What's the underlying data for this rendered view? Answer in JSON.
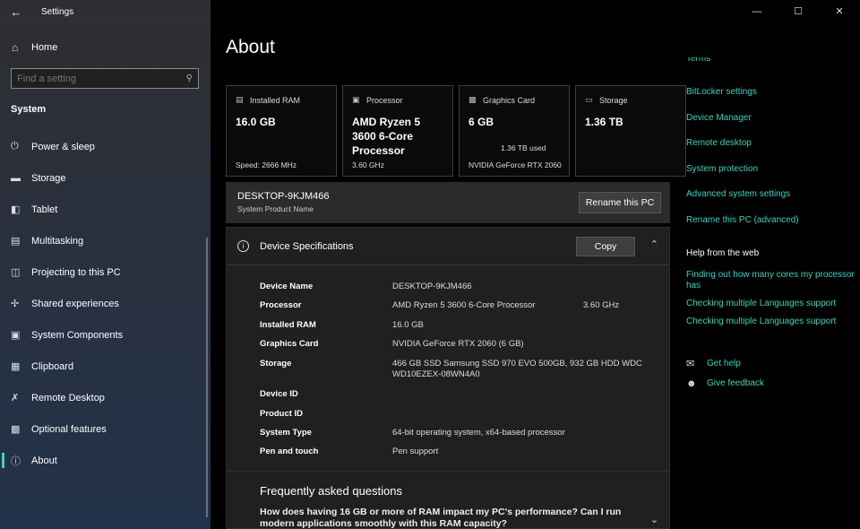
{
  "window": {
    "title": "Settings",
    "controls": [
      "—",
      "☐",
      "✕"
    ]
  },
  "sidebar": {
    "home_label": "Home",
    "search_placeholder": "Find a setting",
    "group_label": "System",
    "items": [
      {
        "label": "Power & sleep",
        "icon": "power-icon"
      },
      {
        "label": "Storage",
        "icon": "storage-icon"
      },
      {
        "label": "Tablet",
        "icon": "tablet-icon"
      },
      {
        "label": "Multitasking",
        "icon": "multitasking-icon"
      },
      {
        "label": "Projecting to this PC",
        "icon": "projecting-icon"
      },
      {
        "label": "Shared experiences",
        "icon": "shared-icon"
      },
      {
        "label": "System Components",
        "icon": "components-icon"
      },
      {
        "label": "Clipboard",
        "icon": "clipboard-icon"
      },
      {
        "label": "Remote Desktop",
        "icon": "remote-icon"
      },
      {
        "label": "Optional features",
        "icon": "features-icon"
      },
      {
        "label": "About",
        "icon": "info-icon",
        "active": true
      }
    ]
  },
  "main": {
    "title": "About",
    "cards": [
      {
        "label": "Installed RAM",
        "value": "16.0 GB",
        "sub": "Speed: 2666 MHz"
      },
      {
        "label": "Processor",
        "value": "AMD Ryzen 5 3600 6-Core Processor",
        "sub": "3.60 GHz"
      },
      {
        "label": "Graphics Card",
        "value": "6 GB",
        "sub": "NVIDIA GeForce RTX 2060"
      },
      {
        "label": "Storage",
        "value": "1.36 TB",
        "sub": "1.36 TB used"
      }
    ],
    "pc_name": {
      "name": "DESKTOP-9KJM466",
      "sub": "System Product Name",
      "rename_label": "Rename this PC"
    },
    "specs": {
      "title": "Device Specifications",
      "copy_label": "Copy",
      "rows": [
        {
          "label": "Device Name",
          "value": "DESKTOP-9KJM466"
        },
        {
          "label": "Processor",
          "value": "AMD Ryzen 5 3600 6-Core Processor",
          "extra": "3.60 GHz"
        },
        {
          "label": "Installed RAM",
          "value": "16.0 GB"
        },
        {
          "label": "Graphics Card",
          "value": "NVIDIA GeForce RTX 2060 (6 GB)"
        },
        {
          "label": "Storage",
          "value": "466 GB SSD Samsung SSD 970 EVO 500GB, 932 GB HDD WDC WD10EZEX-08WN4A0"
        },
        {
          "label": "Device ID",
          "value": ""
        },
        {
          "label": "Product ID",
          "value": ""
        },
        {
          "label": "System Type",
          "value": "64-bit operating system, x64-based processor"
        },
        {
          "label": "Pen and touch",
          "value": "Pen support"
        }
      ]
    },
    "faq": {
      "title": "Frequently asked questions",
      "question": "How does having 16 GB or more of RAM impact my PC's performance? Can I run modern applications smoothly with this RAM capacity?"
    }
  },
  "related": {
    "cut_link": "Terms",
    "links": [
      "BitLocker settings",
      "Device Manager",
      "Remote desktop",
      "System protection",
      "Advanced system settings",
      "Rename this PC (advanced)"
    ],
    "help_title": "Help from the web",
    "web_links": [
      "Finding out how many cores my processor has",
      "Checking multiple Languages support",
      "Checking multiple Languages support"
    ],
    "get_help": "Get help",
    "give_feedback": "Give feedback"
  },
  "colors": {
    "accent": "#3fd1bd",
    "sidebar_top": "#2e2e32",
    "sidebar_bottom": "#22324a",
    "panel": "#202020"
  }
}
